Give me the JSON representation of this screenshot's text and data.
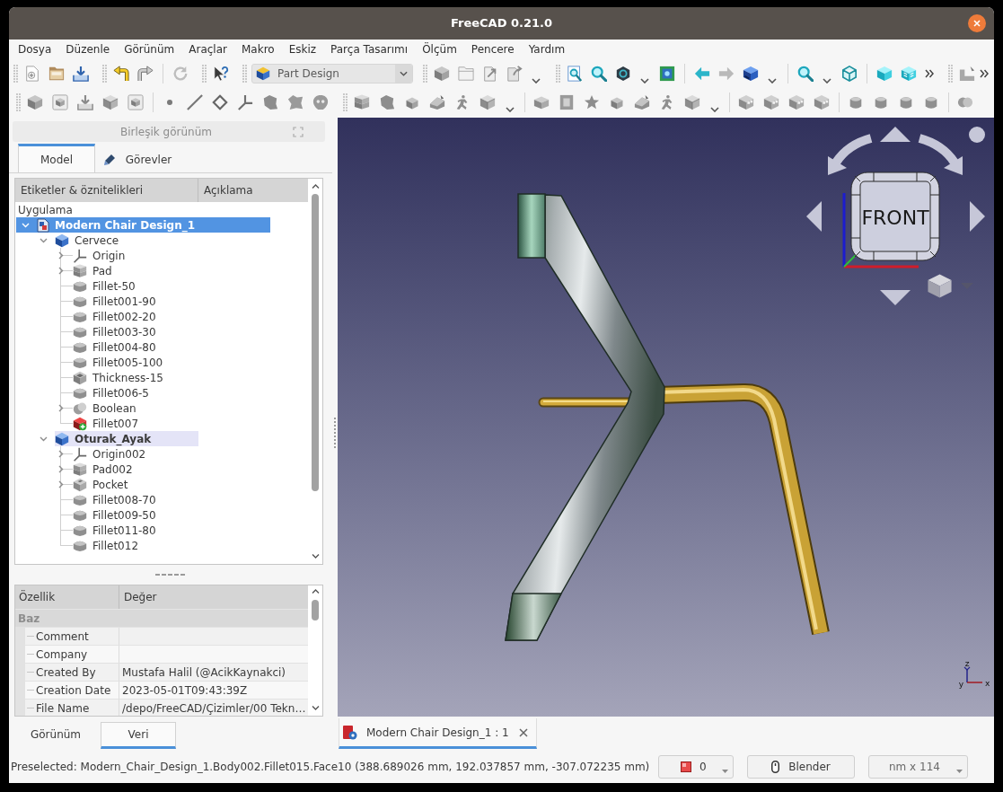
{
  "window": {
    "title": "FreeCAD 0.21.0"
  },
  "menu": [
    "Dosya",
    "Düzenle",
    "Görünüm",
    "Araçlar",
    "Makro",
    "Eskiz",
    "Parça Tasarımı",
    "Ölçüm",
    "Pencere",
    "Yardım"
  ],
  "toolbar": {
    "workbench": "Part Design"
  },
  "combined_view": {
    "title": "Birleşik görünüm",
    "tabs": [
      {
        "label": "Model",
        "kind": "plain",
        "selected": true
      },
      {
        "label": "Görevler",
        "kind": "tasks",
        "selected": false
      }
    ]
  },
  "tree": {
    "columns": [
      "Etiketler & öznitelikleri",
      "Açıklama"
    ],
    "root_label": "Uygulama",
    "items": [
      {
        "label": "Modern Chair Design_1",
        "kind": "document",
        "expanded": true,
        "selected": true,
        "active": true,
        "hovered": false,
        "children": [
          {
            "label": "Cervece",
            "kind": "body",
            "expanded": true,
            "selected": false,
            "active": false,
            "hovered": false,
            "children": [
              {
                "label": "Origin",
                "kind": "origin",
                "expanded": false,
                "selected": false,
                "active": false,
                "hovered": false
              },
              {
                "label": "Pad",
                "kind": "pad",
                "expanded": false,
                "selected": false,
                "active": false,
                "hovered": false
              },
              {
                "label": "Fillet-50",
                "kind": "fillet",
                "selected": false,
                "active": false,
                "hovered": false
              },
              {
                "label": "Fillet001-90",
                "kind": "fillet",
                "selected": false,
                "active": false,
                "hovered": false
              },
              {
                "label": "Fillet002-20",
                "kind": "fillet",
                "selected": false,
                "active": false,
                "hovered": false
              },
              {
                "label": "Fillet003-30",
                "kind": "fillet",
                "selected": false,
                "active": false,
                "hovered": false
              },
              {
                "label": "Fillet004-80",
                "kind": "fillet",
                "selected": false,
                "active": false,
                "hovered": false
              },
              {
                "label": "Fillet005-100",
                "kind": "fillet",
                "selected": false,
                "active": false,
                "hovered": false
              },
              {
                "label": "Thickness-15",
                "kind": "thickness",
                "selected": false,
                "active": false,
                "hovered": false
              },
              {
                "label": "Fillet006-5",
                "kind": "fillet",
                "selected": false,
                "active": false,
                "hovered": false
              },
              {
                "label": "Boolean",
                "kind": "boolean",
                "expanded": false,
                "selected": false,
                "active": false,
                "hovered": false
              },
              {
                "label": "Fillet007",
                "kind": "tip",
                "selected": false,
                "active": false,
                "hovered": false
              }
            ]
          },
          {
            "label": "Oturak_Ayak",
            "kind": "body",
            "expanded": true,
            "selected": false,
            "active": true,
            "hovered": true,
            "children": [
              {
                "label": "Origin002",
                "kind": "origin",
                "expanded": false,
                "selected": false,
                "active": false,
                "hovered": false
              },
              {
                "label": "Pad002",
                "kind": "pad",
                "expanded": false,
                "selected": false,
                "active": false,
                "hovered": false
              },
              {
                "label": "Pocket",
                "kind": "pocket",
                "expanded": false,
                "selected": false,
                "active": false,
                "hovered": false
              },
              {
                "label": "Fillet008-70",
                "kind": "fillet",
                "selected": false,
                "active": false,
                "hovered": false
              },
              {
                "label": "Fillet009-50",
                "kind": "fillet",
                "selected": false,
                "active": false,
                "hovered": false
              },
              {
                "label": "Fillet011-80",
                "kind": "fillet",
                "selected": false,
                "active": false,
                "hovered": false
              },
              {
                "label": "Fillet012",
                "kind": "fillet",
                "selected": false,
                "active": false,
                "hovered": false
              }
            ]
          }
        ]
      }
    ]
  },
  "properties": {
    "columns": [
      "Özellik",
      "Değer"
    ],
    "groups": [
      {
        "name": "Baz",
        "rows": [
          {
            "name": "Comment"
          },
          {
            "name": "Company"
          },
          {
            "name": "Created By",
            "value": "Mustafa Halil (@AcikKaynakci)"
          },
          {
            "name": "Creation Date",
            "value": "2023-05-01T09:43:39Z"
          },
          {
            "name": "File Name",
            "value": "/depo/FreeCAD/Çizimler/00 Tekn…"
          }
        ]
      }
    ]
  },
  "panel_tabs": [
    {
      "label": "Görünüm",
      "selected": false
    },
    {
      "label": "Veri",
      "selected": true
    }
  ],
  "view": {
    "cube_face": "FRONT",
    "axis_labels": [
      "z",
      "y",
      "x"
    ]
  },
  "document_tabs": [
    {
      "label": "Modern Chair Design_1 : 1",
      "selected": true
    }
  ],
  "status_bar": {
    "message": "Preselected: Modern_Chair_Design_1.Body002.Fillet015.Face10 (388.689026 mm, 192.037857 mm, -307.072235 mm)",
    "draw_style": "0",
    "navigation_style": "Blender",
    "dimensions": "nm x 114"
  }
}
